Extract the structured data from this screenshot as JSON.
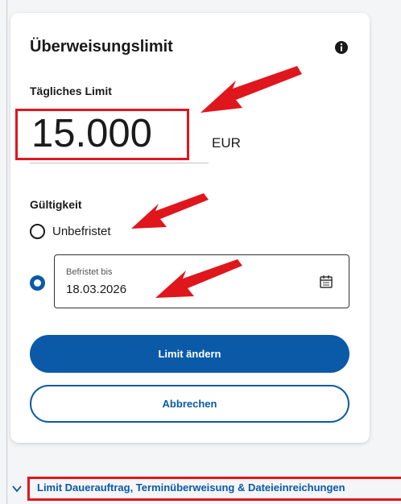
{
  "card": {
    "title": "Überweisungslimit",
    "daily_limit_label": "Tägliches Limit",
    "amount": "15.000",
    "currency": "EUR",
    "validity_label": "Gültigkeit",
    "unlimited_label": "Unbefristet",
    "limited_selected": true,
    "limited_field": {
      "label": "Befristet bis",
      "value": "18.03.2026"
    },
    "primary_button": "Limit ändern",
    "secondary_button": "Abbrechen"
  },
  "footer_link": "Limit Dauerauftrag, Terminüberweisung & Dateieinreichungen",
  "colors": {
    "primary": "#0a5aa8",
    "highlight": "#e0161d"
  },
  "icons": [
    "info-icon",
    "calendar-icon",
    "chevron-down-icon",
    "arrow-annotation"
  ]
}
